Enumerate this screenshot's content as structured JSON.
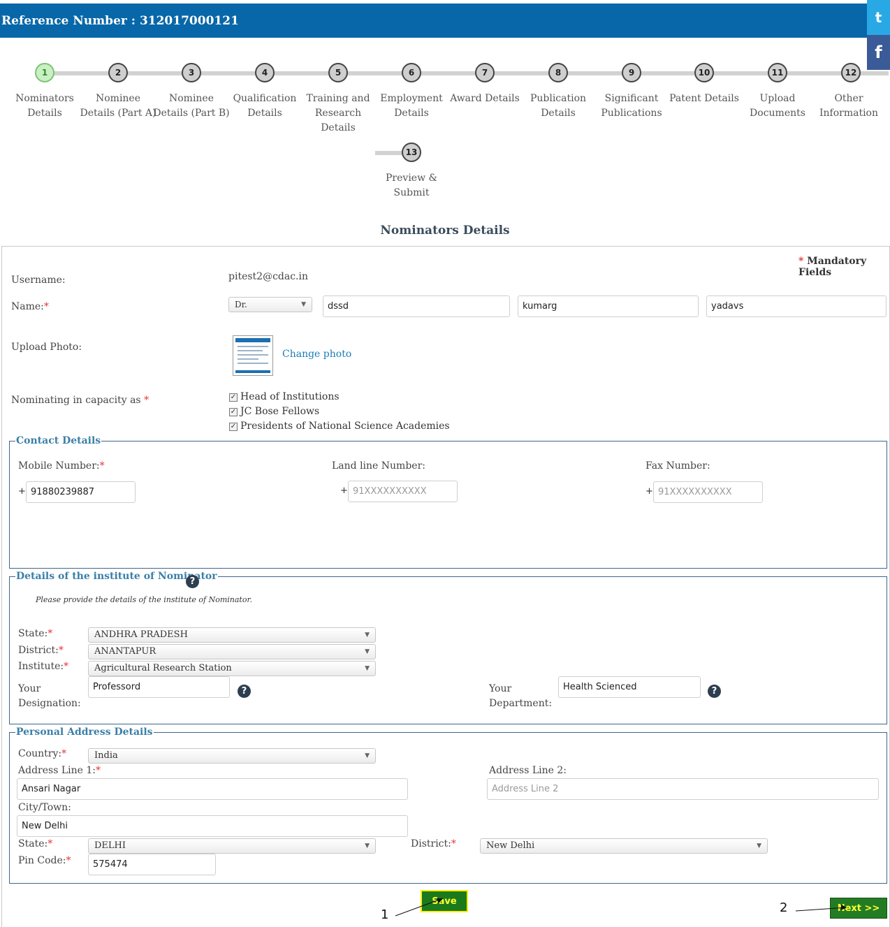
{
  "header": {
    "title": "Reference Number : 312017000121"
  },
  "social": {
    "twitter_glyph": "t",
    "facebook_glyph": "f"
  },
  "steps": [
    {
      "num": "1",
      "label_line1": "Nominators",
      "label_line2": "Details",
      "label_line3": ""
    },
    {
      "num": "2",
      "label_line1": "Nominee",
      "label_line2": "Details (Part A)",
      "label_line3": ""
    },
    {
      "num": "3",
      "label_line1": "Nominee",
      "label_line2": "Details (Part B)",
      "label_line3": ""
    },
    {
      "num": "4",
      "label_line1": "Qualification",
      "label_line2": "Details",
      "label_line3": ""
    },
    {
      "num": "5",
      "label_line1": "Training and",
      "label_line2": "Research",
      "label_line3": "Details"
    },
    {
      "num": "6",
      "label_line1": "Employment",
      "label_line2": "Details",
      "label_line3": ""
    },
    {
      "num": "7",
      "label_line1": "Award Details",
      "label_line2": "",
      "label_line3": ""
    },
    {
      "num": "8",
      "label_line1": "Publication",
      "label_line2": "Details",
      "label_line3": ""
    },
    {
      "num": "9",
      "label_line1": "Significant",
      "label_line2": "Publications",
      "label_line3": ""
    },
    {
      "num": "10",
      "label_line1": "Patent Details",
      "label_line2": "",
      "label_line3": ""
    },
    {
      "num": "11",
      "label_line1": "Upload",
      "label_line2": "Documents",
      "label_line3": ""
    },
    {
      "num": "12",
      "label_line1": "Other",
      "label_line2": "Information",
      "label_line3": ""
    },
    {
      "num": "13",
      "label_line1": "Preview &",
      "label_line2": "Submit",
      "label_line3": ""
    }
  ],
  "page_title": "Nominators Details",
  "mandatory_note": "Mandatory Fields",
  "required_mark": "*",
  "form": {
    "username_label": "Username:",
    "username_value": "pitest2@cdac.in",
    "name_label": "Name:",
    "salutation": "Dr.",
    "first_name": "dssd",
    "middle_name": "kumarg",
    "last_name": "yadavs",
    "upload_photo_label": "Upload Photo:",
    "change_photo": "Change photo",
    "capacity_label": "Nominating in capacity as",
    "capacities": [
      "Head of Institutions",
      "JC Bose Fellows",
      "Presidents of National Science Academies"
    ],
    "checkbox_mark": "✓"
  },
  "contact": {
    "legend": "Contact Details",
    "mobile_label": "Mobile Number:",
    "mobile_value": "91880239887",
    "landline_label": "Land line Number:",
    "landline_placeholder": "91XXXXXXXXXX",
    "fax_label": "Fax Number:",
    "fax_placeholder": "91XXXXXXXXXX",
    "plus": "+"
  },
  "institute": {
    "legend": "Details of the institute of Nominator",
    "note": "Please provide the details of the institute of Nominator.",
    "state_label": "State:",
    "state_value": "ANDHRA PRADESH",
    "district_label": "District:",
    "district_value": "ANANTAPUR",
    "institute_label": "Institute:",
    "institute_value": "Agricultural Research Station",
    "designation_label_1": "Your",
    "designation_label_2": "Designation:",
    "designation_value": "Professord",
    "department_label_1": "Your",
    "department_label_2": "Department:",
    "department_value": "Health Scienced",
    "help_glyph": "?"
  },
  "address": {
    "legend": "Personal Address Details",
    "country_label": "Country:",
    "country_value": "India",
    "line1_label": "Address Line 1:",
    "line1_value": "Ansari Nagar",
    "line2_label": "Address Line 2:",
    "line2_placeholder": "Address Line 2",
    "city_label": "City/Town:",
    "city_value": "New Delhi",
    "state_label": "State:",
    "state_value": "DELHI",
    "district_label": "District:",
    "district_value": "New Delhi",
    "pin_label": "Pin Code:",
    "pin_value": "575474"
  },
  "buttons": {
    "save": "Save",
    "next": "Next >>"
  },
  "callouts": {
    "one": "1",
    "two": "2"
  },
  "dropdown_caret": "▼"
}
